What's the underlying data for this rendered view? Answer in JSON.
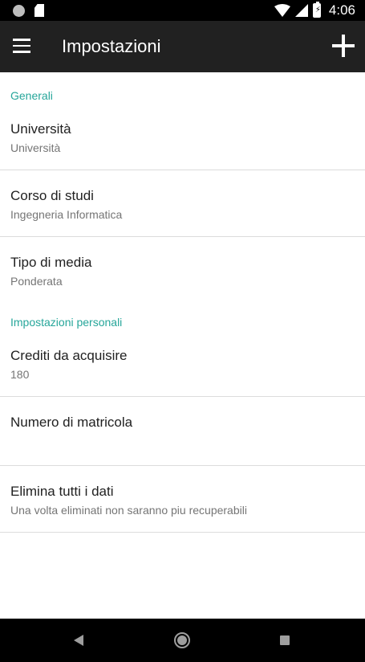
{
  "status_bar": {
    "time": "4:06",
    "icons": [
      "notification-dot-icon",
      "sd-card-icon",
      "wifi-icon",
      "signal-icon",
      "battery-charging-icon"
    ]
  },
  "toolbar": {
    "title": "Impostazioni",
    "menu_icon": "hamburger-menu-icon",
    "action_icon": "add-icon"
  },
  "sections": [
    {
      "header": "Generali",
      "items": [
        {
          "title": "Università",
          "summary": "Università"
        },
        {
          "title": "Corso di studi",
          "summary": "Ingegneria Informatica"
        },
        {
          "title": "Tipo di media",
          "summary": "Ponderata"
        }
      ]
    },
    {
      "header": "Impostazioni personali",
      "items": [
        {
          "title": "Crediti da acquisire",
          "summary": "180"
        },
        {
          "title": "Numero di matricola",
          "summary": ""
        },
        {
          "title": "Elimina tutti i dati",
          "summary": "Una volta eliminati non saranno piu recuperabili"
        }
      ]
    }
  ],
  "nav_bar": {
    "icons": [
      "back-icon",
      "home-icon",
      "recent-apps-icon"
    ]
  },
  "colors": {
    "status_bar": "#000000",
    "toolbar": "#212121",
    "accent": "#26a69a",
    "divider": "#dcdcdc",
    "title_text": "#212121",
    "summary_text": "#757575"
  }
}
